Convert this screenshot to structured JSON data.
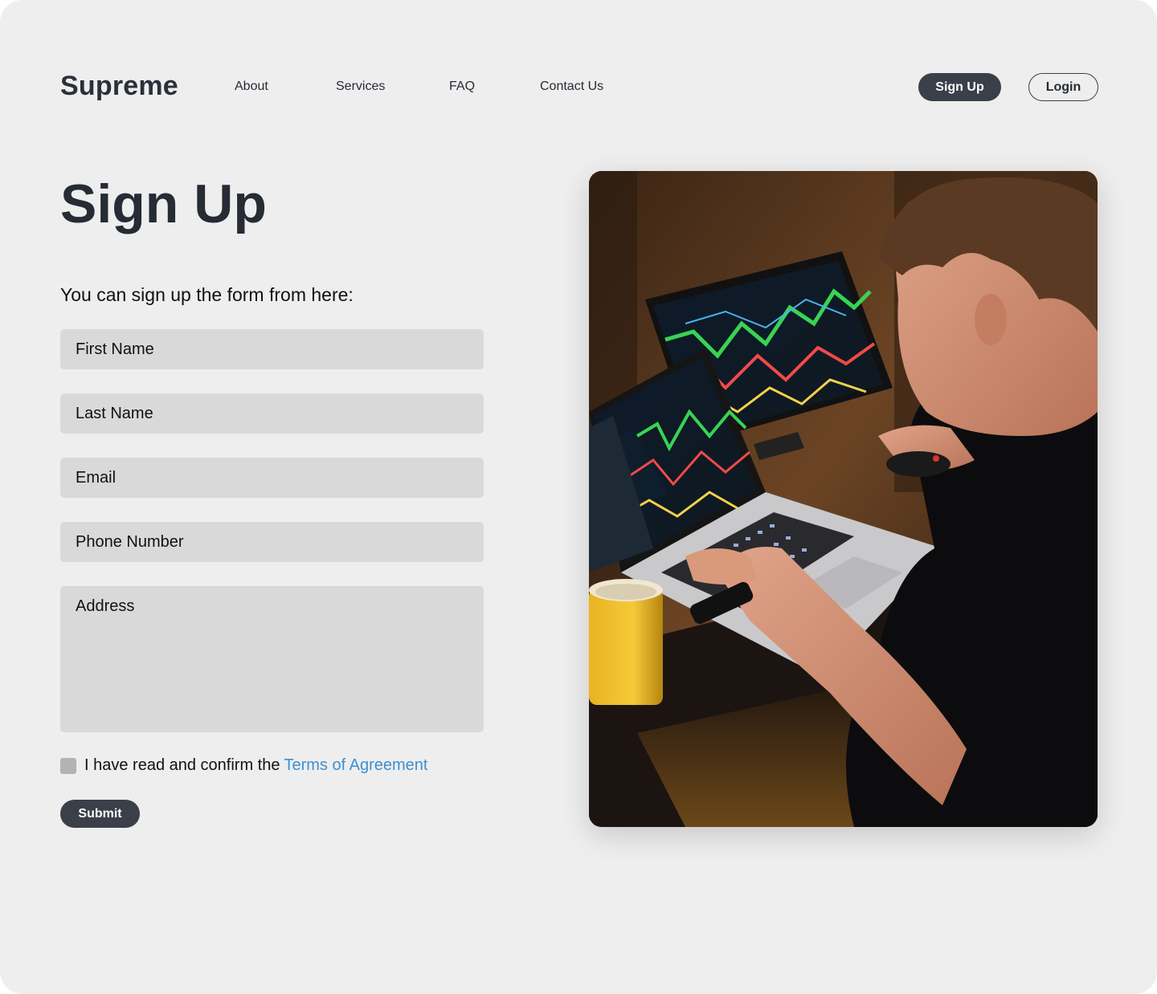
{
  "brand": {
    "name": "Supreme"
  },
  "nav": {
    "items": [
      {
        "label": "About"
      },
      {
        "label": "Services"
      },
      {
        "label": "FAQ"
      },
      {
        "label": "Contact Us"
      }
    ]
  },
  "header": {
    "signup_label": "Sign Up",
    "login_label": "Login"
  },
  "main": {
    "title": "Sign Up",
    "subtitle": "You can sign up the form from here:"
  },
  "form": {
    "first_name_placeholder": "First Name",
    "last_name_placeholder": "Last Name",
    "email_placeholder": "Email",
    "phone_placeholder": "Phone Number",
    "address_placeholder": "Address",
    "agree_text": "I have read and confirm the",
    "terms_link": "Terms of Agreement",
    "submit_label": "Submit"
  },
  "colors": {
    "background": "#eeeeee",
    "dark_button": "#3a3f49",
    "field": "#d9d9d9",
    "link": "#3d8fd1",
    "text": "#262b34"
  }
}
